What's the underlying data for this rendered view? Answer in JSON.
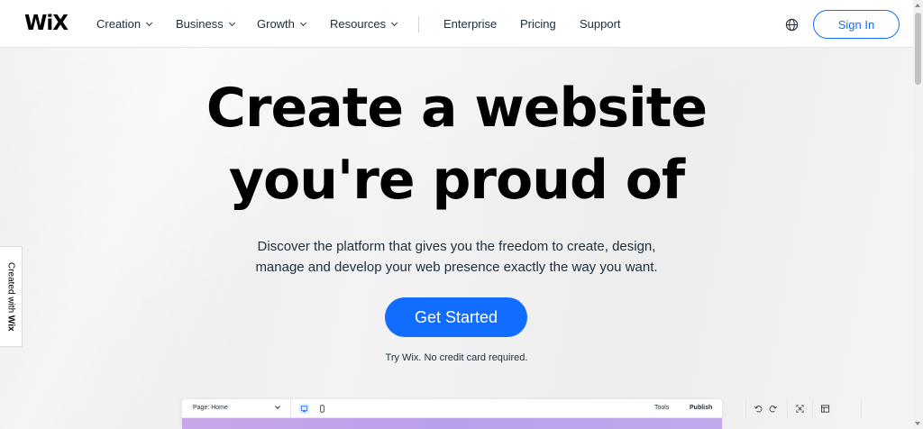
{
  "header": {
    "logo": "WiX",
    "nav": [
      "Creation",
      "Business",
      "Growth",
      "Resources"
    ],
    "links": [
      "Enterprise",
      "Pricing",
      "Support"
    ],
    "signin": "Sign In"
  },
  "hero": {
    "line1": "Create a website",
    "line2": "you're proud of",
    "sub1": "Discover the platform that gives you the freedom to create, design,",
    "sub2": "manage and develop your web presence exactly the way you want.",
    "cta": "Get Started",
    "note": "Try Wix. No credit card required."
  },
  "side_tab": {
    "prefix": "Created with ",
    "brand": "Wix"
  },
  "editor": {
    "page": "Page: Home",
    "tools": "Tools",
    "publish": "Publish"
  },
  "colors": {
    "accent": "#116dff",
    "preview_gradient": "#c8a6e8"
  },
  "icons": [
    "chevron-down-icon",
    "globe-icon",
    "desktop-icon",
    "mobile-icon",
    "undo-icon",
    "redo-icon",
    "zoom-fit-icon",
    "tools-icon"
  ]
}
